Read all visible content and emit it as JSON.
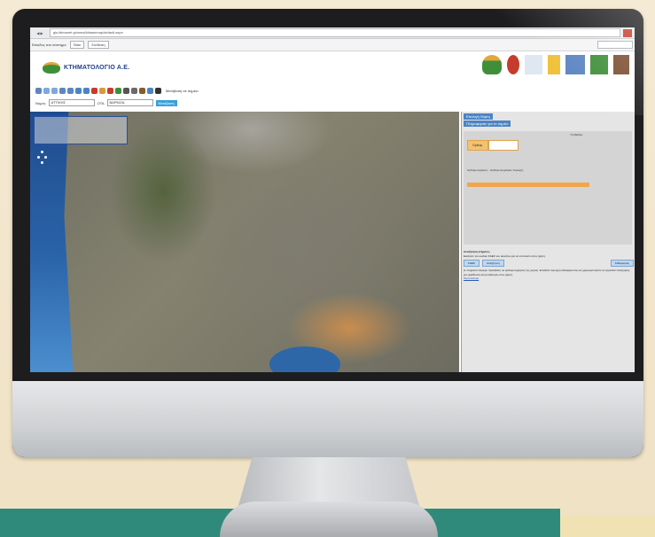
{
  "browser": {
    "url": "gis.ktimanet.gr/wms/ktbasemap/default.aspx",
    "nav_label": "◀ ▶",
    "fav_text": "Είσοδος στο σύστημα",
    "search_prefix": "Πάτε",
    "search_btn": "Σύνδεση"
  },
  "site": {
    "org_name": "ΚΤΗΜΑΤΟΛΟΓΙΟ Α.Ε.",
    "toolbar_label": "Μετάβαση σε σημείο",
    "search_label": "Νομός",
    "search_value": "ΑΤΤΙΚΗΣ",
    "muni_label": "ΟΤΑ",
    "muni_value": "ΒΑΡΚΙΖΑ",
    "go_label": "Μετάβαση"
  },
  "panel": {
    "title1": "Επιλογή Χάρτη",
    "title2": "Πληροφορίες για το σημείο",
    "group_label": "Υπόβαθρο",
    "tab1": "Ορθοφ.",
    "tab2": "",
    "gtext": "Ορθοφωτοχάρτες - Ορθοφωτογραφίες περιοχής",
    "info_heading": "Αναζήτηση κτήματος",
    "info_sub": "Εισάγετε τον κωδικό ΚΑΕΚ του ακινήτου για να εντοπιστεί στον χάρτη.",
    "btn1": "ΚΑΕΚ",
    "btn2": "Αναζήτηση",
    "btn3": "Καθαρισμός",
    "info_body": "Η υπηρεσία παρέχει πρόσβαση σε ορθοφωτοχάρτες της χώρας. Επιλέξτε περιοχή ενδιαφέροντος και χρησιμοποιήστε τα εργαλεία πλοήγησης για μεγέθυνση και μετακίνηση στον χάρτη.",
    "link": "Περισσότερα"
  },
  "colors": {
    "brand_blue": "#1d3f8a",
    "accent_orange": "#f2a54c",
    "sea": "#2a63a8"
  }
}
